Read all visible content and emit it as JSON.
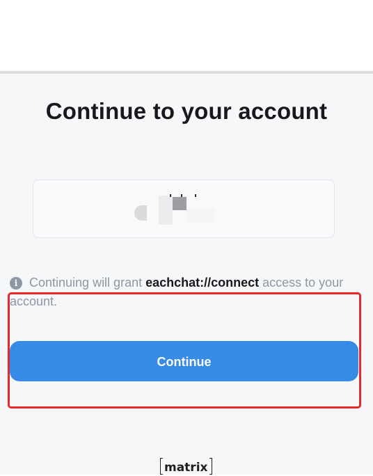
{
  "title": "Continue to your account",
  "account": {
    "label": "blurred account avatar and username"
  },
  "notice": {
    "prefix": "Continuing will grant ",
    "app": "eachchat://connect",
    "suffix": " access to your account.",
    "icon": "info-icon"
  },
  "actions": {
    "continue_label": "Continue"
  },
  "footer": {
    "logo_text": "matrix"
  },
  "colors": {
    "accent": "#378ae6",
    "highlight": "#e8282a",
    "muted_text": "#8d97a5"
  }
}
